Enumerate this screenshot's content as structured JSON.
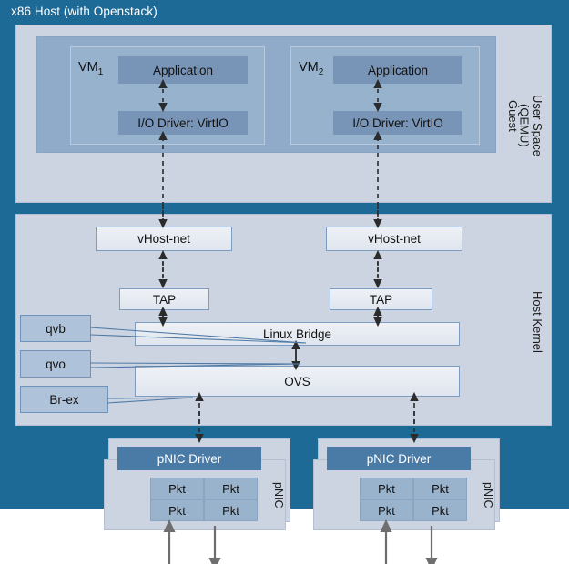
{
  "diagram": {
    "title": "x86 Host (with Openstack)",
    "colors": {
      "host_bg": "#1d6a96",
      "panel_bg": "#ccd4e1",
      "guest_bg": "#8fabc9",
      "vm_bg": "#97b2cd",
      "dark_box": "#7895b8",
      "light_box": "#e3e8f0",
      "callout": "#aec3da",
      "driver_bar": "#4a7ba7",
      "pkt": "#9ab3cd",
      "arrow": "#555555",
      "border": "#7e9cc0"
    }
  },
  "user_space": {
    "side_label": "User Space\n(QEMU)",
    "guest_label": "Guest",
    "vms": [
      {
        "tag": "VM",
        "index": "1",
        "application": "Application",
        "io_driver": "I/O Driver: VirtIO"
      },
      {
        "tag": "VM",
        "index": "2",
        "application": "Application",
        "io_driver": "I/O Driver: VirtIO"
      }
    ]
  },
  "host_kernel": {
    "side_label": "Host Kernel",
    "vhost_left": "vHost-net",
    "vhost_right": "vHost-net",
    "tap_left": "TAP",
    "tap_right": "TAP",
    "linux_bridge": "Linux Bridge",
    "ovs": "OVS",
    "callouts": [
      {
        "label": "qvb"
      },
      {
        "label": "qvo"
      },
      {
        "label": "Br-ex"
      }
    ]
  },
  "pnics": [
    {
      "side_label": "pNIC",
      "driver": "pNIC Driver",
      "packets": [
        "Pkt",
        "Pkt",
        "Pkt",
        "Pkt"
      ]
    },
    {
      "side_label": "pNIC",
      "driver": "pNIC Driver",
      "packets": [
        "Pkt",
        "Pkt",
        "Pkt",
        "Pkt"
      ]
    }
  ]
}
